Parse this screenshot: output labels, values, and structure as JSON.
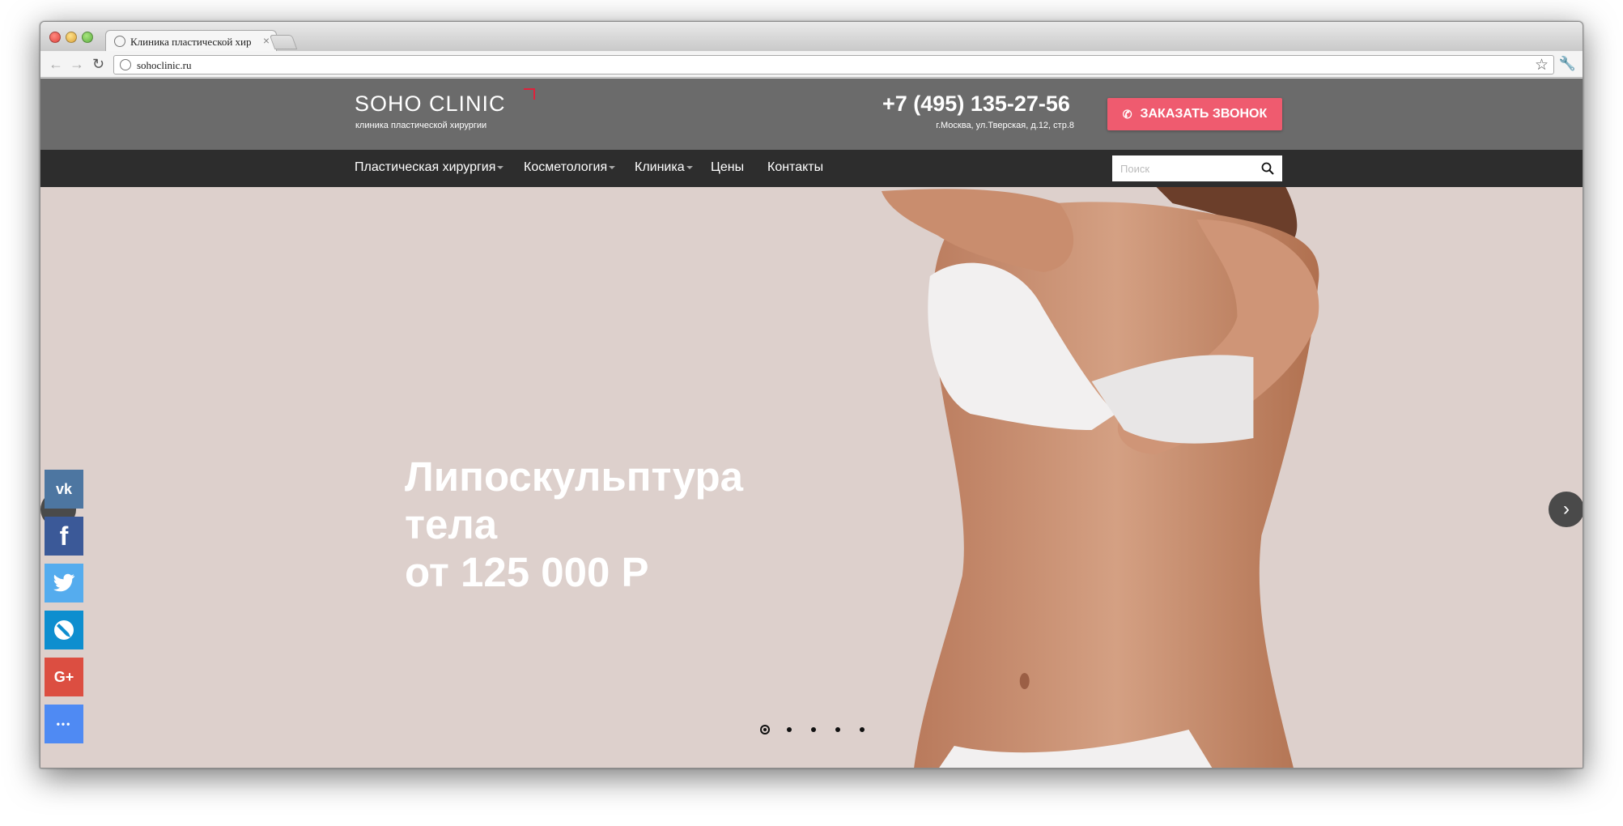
{
  "browser": {
    "tab_title": "Клиника пластической хир",
    "tab_close": "×",
    "url": "sohoclinic.ru"
  },
  "header": {
    "logo": "SOHO CLINIC",
    "logo_sub": "клиника пластической хирургии",
    "phone": "+7 (495) 135-27-56",
    "address": "г.Москва, ул.Тверская, д.12, стр.8",
    "cta_label": "ЗАКАЗАТЬ ЗВОНОК"
  },
  "nav": {
    "items": [
      {
        "label": "Пластическая хирургия",
        "dropdown": true
      },
      {
        "label": "Косметология",
        "dropdown": true
      },
      {
        "label": "Клиника",
        "dropdown": true
      },
      {
        "label": "Цены",
        "dropdown": false
      },
      {
        "label": "Контакты",
        "dropdown": false
      }
    ],
    "search_placeholder": "Поиск"
  },
  "hero": {
    "line1": "Липоскульптура",
    "line2": "тела",
    "line3": "от 125 000 Р",
    "slides_total": 5,
    "active_slide": 1
  },
  "social": [
    {
      "name": "vk",
      "label": "vk",
      "color": "#4d76a1"
    },
    {
      "name": "facebook",
      "label": "f",
      "color": "#3b5998"
    },
    {
      "name": "twitter",
      "label": "",
      "color": "#55acee"
    },
    {
      "name": "livejournal",
      "label": "",
      "color": "#0d8ecf"
    },
    {
      "name": "google-plus",
      "label": "G+",
      "color": "#dc4e41"
    },
    {
      "name": "more",
      "label": "•••",
      "color": "#4f8af3"
    }
  ],
  "colors": {
    "header_bg": "#6b6b6b",
    "nav_bg": "#2d2d2d",
    "cta": "#ef5b6f",
    "hero_bg": "#ddd0cc",
    "logo_accent": "#e0213b"
  }
}
